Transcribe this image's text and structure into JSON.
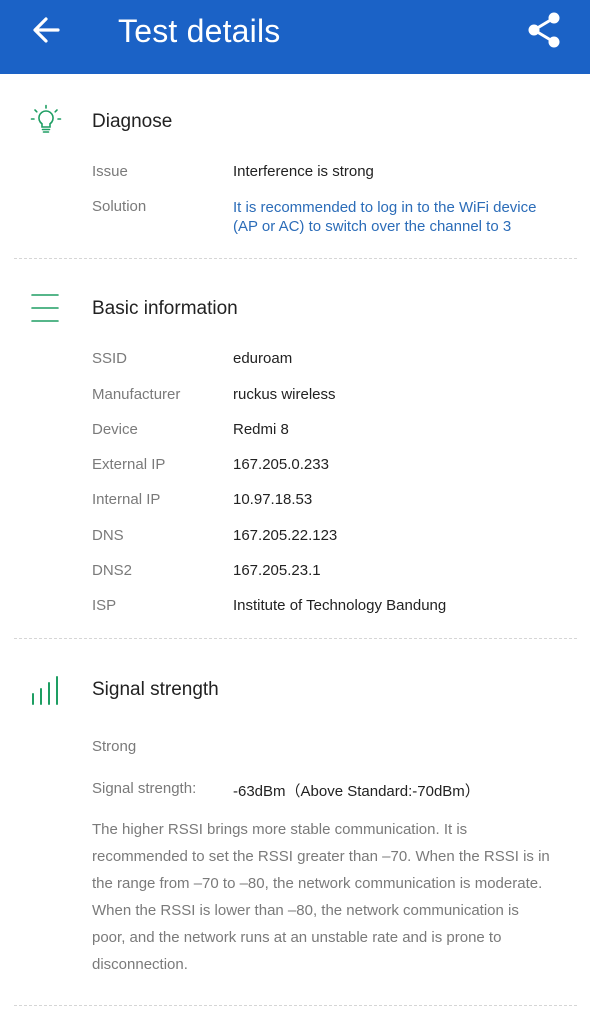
{
  "header": {
    "title": "Test details"
  },
  "diagnose": {
    "title": "Diagnose",
    "issue_label": "Issue",
    "issue_value": "Interference is strong",
    "solution_label": "Solution",
    "solution_value": "It is recommended to log in to the WiFi device (AP or AC) to switch over the channel to 3"
  },
  "basic": {
    "title": "Basic information",
    "rows": [
      {
        "label": "SSID",
        "value": "eduroam"
      },
      {
        "label": "Manufacturer",
        "value": "ruckus wireless"
      },
      {
        "label": "Device",
        "value": "Redmi 8"
      },
      {
        "label": "External IP",
        "value": "167.205.0.233"
      },
      {
        "label": "Internal IP",
        "value": "10.97.18.53"
      },
      {
        "label": "DNS",
        "value": "167.205.22.123"
      },
      {
        "label": "DNS2",
        "value": "167.205.23.1"
      },
      {
        "label": "ISP",
        "value": "Institute of Technology Bandung"
      }
    ]
  },
  "signal": {
    "title": "Signal strength",
    "level": "Strong",
    "strength_label": "Signal strength:",
    "strength_value": "-63dBm（Above Standard:-70dBm）",
    "description": "The higher RSSI brings more stable communication. It is recommended to set the RSSI greater than –70. When the RSSI is in the range from –70 to –80, the network communication is moderate. When the RSSI is lower than –80, the network communication is poor, and the network runs at an unstable rate and is prone to disconnection."
  },
  "colors": {
    "appbar": "#1b62c6",
    "accent_green": "#1e9e63",
    "link": "#2b6cb8"
  },
  "icons": {
    "back": "arrow-left-icon",
    "share": "share-icon",
    "diagnose": "lightbulb-icon",
    "basic": "menu-lines-icon",
    "signal": "signal-bars-icon"
  }
}
